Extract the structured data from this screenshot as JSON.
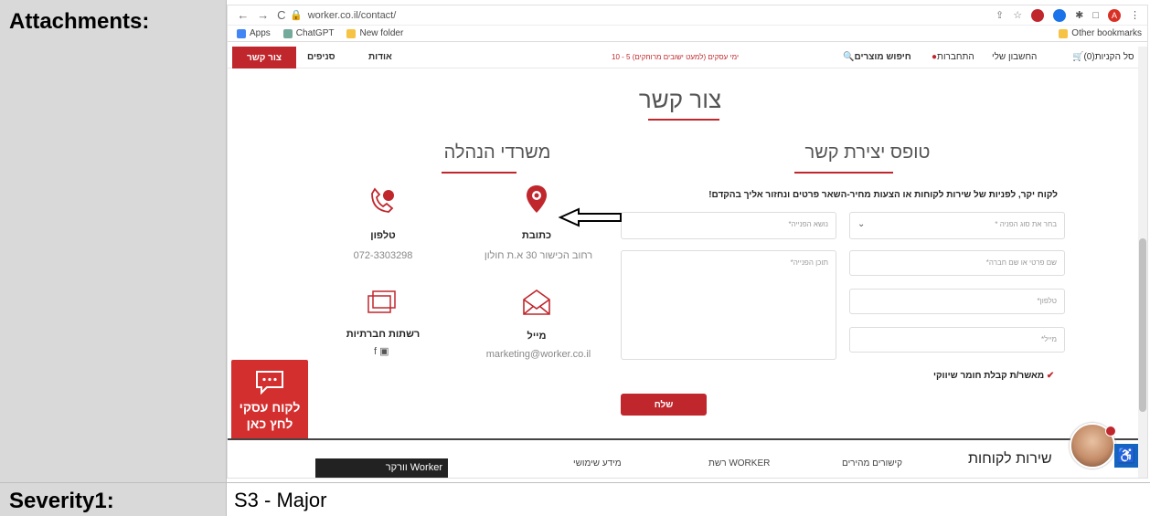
{
  "table": {
    "attachments_label": "Attachments:",
    "severity_label": "Severity1:",
    "severity_value": "S3 - Major"
  },
  "browser": {
    "url": "worker.co.il/contact/",
    "bookmarks": [
      "Apps",
      "ChatGPT",
      "New folder"
    ],
    "other_bookmarks": "Other bookmarks",
    "profile_initial": "A"
  },
  "site_nav": {
    "contact": "צור קשר",
    "branches": "סניפים",
    "about": "אודות",
    "promo": "10 - 5 ימי עסקים (למעט ישובים מרוחקים)",
    "search": "חיפוש מוצרים",
    "login": "התחברות",
    "account": "החשבון שלי",
    "cart": "סל הקניות(0)"
  },
  "page": {
    "title": "צור קשר",
    "form_title": "טופס יצירת קשר",
    "offices_title": "משרדי הנהלה",
    "intro": "לקוח יקר, לפניות של שירות לקוחות או הצעות מחיר-השאר פרטים ונחזור אליך בהקדם!",
    "fields": {
      "type": "בחר את סוג הפניה *",
      "subject": "נושא הפנייה*",
      "name": "שם פרטי או שם חברה*",
      "content": "תוכן הפנייה*",
      "phone": "טלפון*",
      "email": "מייל*"
    },
    "consent": "מאשר/ת קבלת חומר שיווקי",
    "send": "שלח"
  },
  "offices": {
    "phone_label": "טלפון",
    "phone_value": "072-3303298",
    "address_label": "כתובת",
    "address_value": "רחוב הכישור 30 א.ת חולון",
    "social_label": "רשתות חברתיות",
    "mail_label": "מייל",
    "mail_value": "marketing@worker.co.il"
  },
  "biz": {
    "line1": "לקוח עסקי",
    "line2": "לחץ כאן"
  },
  "footer": {
    "service": "שירות לקוחות",
    "links": "קישורים מהירים",
    "network": "רשת WORKER",
    "info": "מידע שימושי",
    "thumb": "וורקר Worker"
  },
  "colors": {
    "brand_red": "#c0272d",
    "label_bg": "#d9d9d9"
  }
}
